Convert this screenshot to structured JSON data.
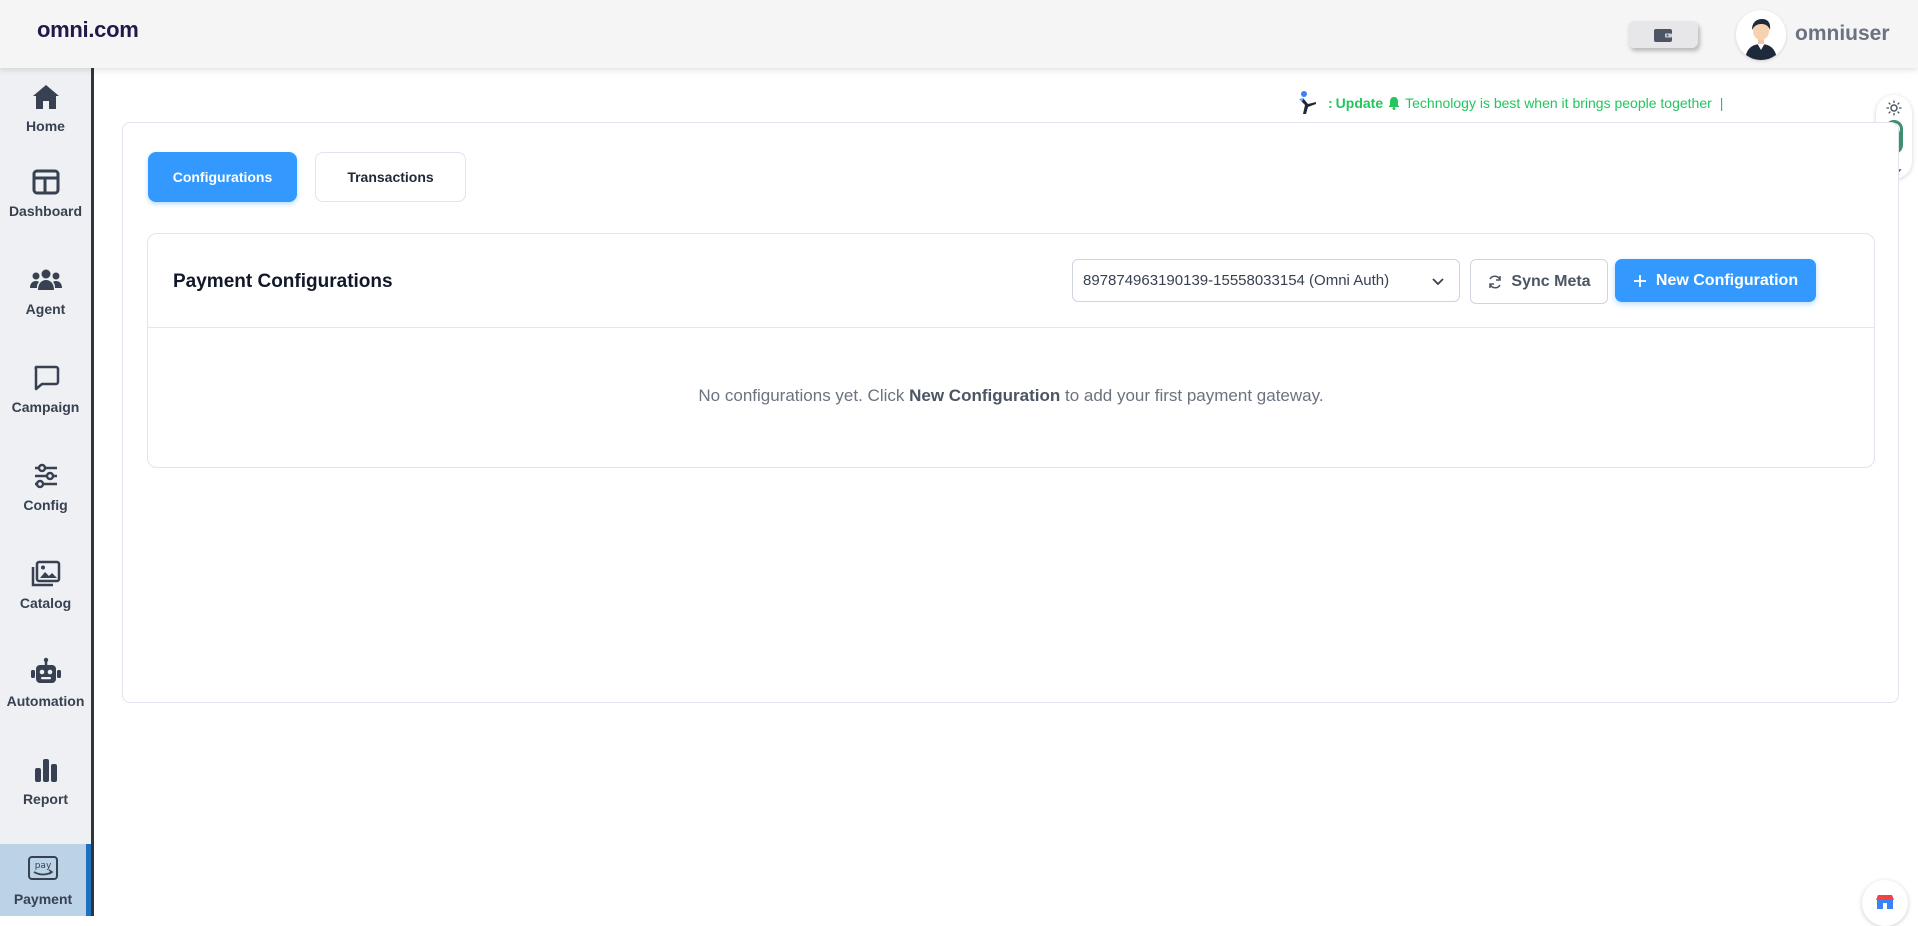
{
  "header": {
    "brand": "omni.com",
    "username": "omniuser"
  },
  "sidebar": {
    "items": [
      {
        "label": "Home",
        "icon": "home-icon"
      },
      {
        "label": "Dashboard",
        "icon": "dashboard-icon"
      },
      {
        "label": "Agent",
        "icon": "users-icon"
      },
      {
        "label": "Campaign",
        "icon": "chat-bubble-icon"
      },
      {
        "label": "Config",
        "icon": "sliders-icon"
      },
      {
        "label": "Catalog",
        "icon": "images-icon"
      },
      {
        "label": "Automation",
        "icon": "robot-icon"
      },
      {
        "label": "Report",
        "icon": "bar-chart-icon"
      },
      {
        "label": "Payment",
        "icon": "pay-icon",
        "active": true
      }
    ]
  },
  "ticker": {
    "prefix": ":",
    "label": "Update",
    "message": "Technology is best when it brings people together",
    "cursor": "|"
  },
  "tabs": [
    {
      "label": "Configurations",
      "active": true
    },
    {
      "label": "Transactions",
      "active": false
    }
  ],
  "payment": {
    "title": "Payment Configurations",
    "selected_account": "897874963190139-15558033154 (Omni Auth)",
    "sync_label": "Sync Meta",
    "new_label": "New Configuration",
    "empty_before": "No configurations yet. Click",
    "empty_strong": "New Configuration",
    "empty_after": "to add your first payment gateway."
  },
  "colors": {
    "accent": "#3399ff",
    "ticker_green": "#22c55e",
    "sidebar_active": "#bcd2e6"
  }
}
